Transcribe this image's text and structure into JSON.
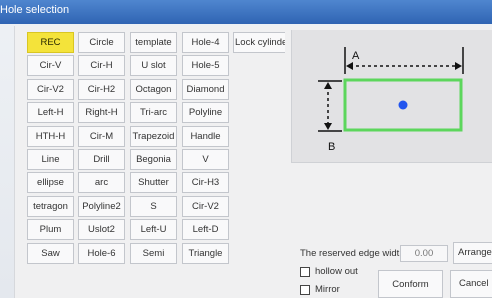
{
  "window": {
    "title": "Hole selection"
  },
  "shapes": [
    [
      "REC",
      "Circle",
      "template",
      "Hole-4",
      "Lock cylinder"
    ],
    [
      "Cir-V",
      "Cir-H",
      "U slot",
      "Hole-5"
    ],
    [
      "Cir-V2",
      "Cir-H2",
      "Octagon",
      "Diamond"
    ],
    [
      "Left-H",
      "Right-H",
      "Tri-arc",
      "Polyline"
    ],
    [
      "HTH-H",
      "Cir-M",
      "Trapezoid",
      "Handle"
    ],
    [
      "Line",
      "Drill",
      "Begonia",
      "V"
    ],
    [
      "ellipse",
      "arc",
      "Shutter",
      "Cir-H3"
    ],
    [
      "tetragon",
      "Polyline2",
      "S",
      "Cir-V2"
    ],
    [
      "Plum",
      "Uslot2",
      "Left-U",
      "Left-D"
    ],
    [
      "Saw",
      "Hole-6",
      "Semi",
      "Triangle"
    ]
  ],
  "selected_shape": "REC",
  "preview": {
    "dim_a": "A",
    "dim_b": "B",
    "shape_color": "#5cd65c",
    "dot_color": "#2255ee"
  },
  "reserved_edge": {
    "label": "The reserved edge widt",
    "value": "0.00"
  },
  "buttons": {
    "arrange": "Arrange",
    "conform": "Conform",
    "cancel": "Cancel"
  },
  "options": {
    "hollow_out": "hollow out",
    "mirror": "Mirror"
  },
  "colors": {
    "selected": "#f4e33a",
    "titlebar": "#3a71bf"
  }
}
